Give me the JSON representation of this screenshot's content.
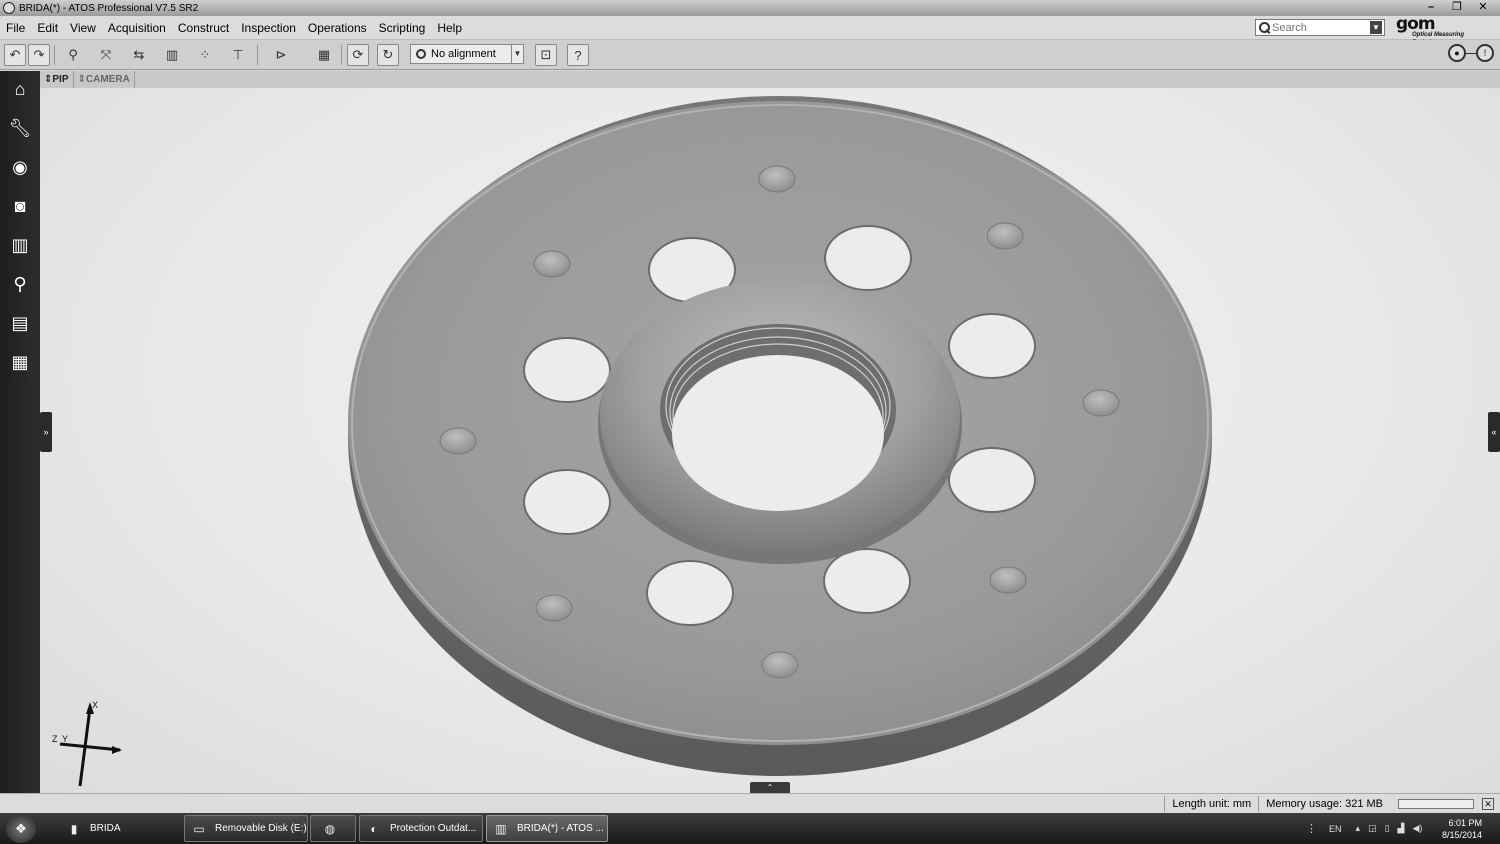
{
  "window": {
    "title": "BRIDA(*) - ATOS Professional V7.5 SR2",
    "controls": [
      "–",
      "❐",
      "✕"
    ]
  },
  "menu": [
    "File",
    "Edit",
    "View",
    "Acquisition",
    "Construct",
    "Inspection",
    "Operations",
    "Scripting",
    "Help"
  ],
  "search": {
    "placeholder": "Search"
  },
  "logo": {
    "main": "gom",
    "sub": "Optical Measuring Techniques"
  },
  "toolbar": {
    "alignment_label": "No alignment",
    "help_label": "?",
    "icons": [
      "undo-icon",
      "redo-icon",
      "point-select-icon",
      "surface-select-icon",
      "transform-icon",
      "scale-bars-icon",
      "points-icon",
      "frame-icon",
      "record-icon",
      "checker-icon",
      "refresh-icon",
      "rotate-icon",
      "align-icon",
      "help-icon"
    ]
  },
  "sidebar": [
    "home-icon",
    "wrench-icon",
    "sensor-icon",
    "camera-icon",
    "scale-icon",
    "zoom-icon",
    "report-icon",
    "grid-icon"
  ],
  "view_tabs": [
    {
      "label": "PIP"
    },
    {
      "label": "CAMERA"
    }
  ],
  "viewport": {
    "axis_labels": {
      "x": "X",
      "y": "Y",
      "z": "Z"
    },
    "expand_left": "»",
    "expand_right": "«",
    "expand_bottom": "⌃"
  },
  "status": {
    "length_unit": "Length unit: mm",
    "memory": "Memory usage: 321 MB",
    "close": "✕"
  },
  "taskbar": {
    "items": [
      {
        "label": "BRIDA",
        "icon": "folder-icon"
      },
      {
        "label": "Removable Disk (E:)",
        "icon": "disk-icon"
      },
      {
        "label": "",
        "icon": "firefox-icon"
      },
      {
        "label": "Protection Outdat...",
        "icon": "shield-icon"
      },
      {
        "label": "BRIDA(*) - ATOS ...",
        "icon": "atos-icon"
      }
    ],
    "language": "EN",
    "time": "6:01 PM",
    "date": "8/15/2014"
  }
}
